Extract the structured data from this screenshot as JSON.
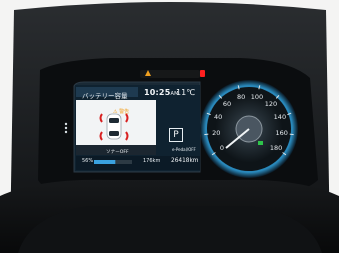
{
  "display": {
    "tab_title": "バッテリー容量",
    "clock": "10:25",
    "clock_ampm": "AM",
    "outside_temp": "11℃",
    "warning_label": "⚠ 警告",
    "warning_message": "ソナーOFF",
    "park_symbol": "P",
    "epark_label": "e-Pedal/OFF",
    "battery_percent": "56%",
    "range": "176km",
    "odometer": "26418km"
  },
  "speedometer": {
    "ticks": [
      "0",
      "20",
      "40",
      "60",
      "80",
      "100",
      "120",
      "140",
      "160",
      "180"
    ]
  },
  "indicators": {
    "amber_lamp": "#f0a020",
    "red_lamp": "#ff2020",
    "ring_glow": "#2b8fc2"
  },
  "battery_gauge": {
    "level": 0.56
  }
}
